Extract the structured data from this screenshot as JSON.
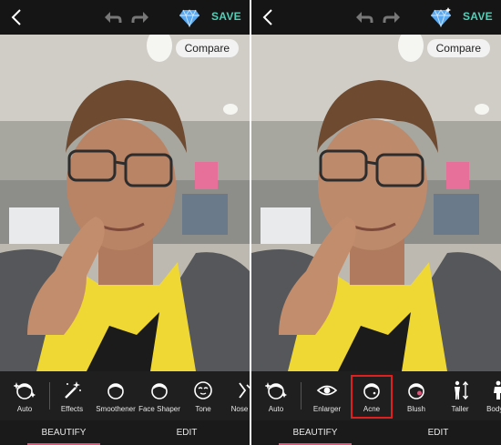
{
  "colors": {
    "accent": "#4fd1b8",
    "tab_indicator": "#e0547a",
    "highlight": "#e02020"
  },
  "left_screen": {
    "header": {
      "back_icon": "chevron-left-icon",
      "undo_icon": "undo-icon",
      "redo_icon": "redo-icon",
      "premium_icon": "diamond-icon",
      "save_label": "SAVE"
    },
    "compare_label": "Compare",
    "tools": [
      {
        "label": "Auto",
        "icon": "auto-face-icon"
      },
      {
        "label": "Effects",
        "icon": "magic-wand-icon"
      },
      {
        "label": "Smoothener",
        "icon": "face-smooth-icon"
      },
      {
        "label": "Face Shaper",
        "icon": "face-shaper-icon"
      },
      {
        "label": "Tone",
        "icon": "tone-icon"
      },
      {
        "label": "Nose En",
        "icon": "nose-icon"
      }
    ],
    "tabs": [
      {
        "label": "BEAUTIFY",
        "active": true
      },
      {
        "label": "EDIT",
        "active": false
      }
    ]
  },
  "right_screen": {
    "header": {
      "back_icon": "chevron-left-icon",
      "undo_icon": "undo-icon",
      "redo_icon": "redo-icon",
      "premium_icon": "diamond-sparkle-icon",
      "save_label": "SAVE"
    },
    "compare_label": "Compare",
    "tools": [
      {
        "label": "Auto",
        "icon": "auto-face-icon"
      },
      {
        "label": "Enlarger",
        "icon": "eye-icon"
      },
      {
        "label": "Acne",
        "icon": "acne-icon",
        "selected": true
      },
      {
        "label": "Blush",
        "icon": "blush-icon"
      },
      {
        "label": "Taller",
        "icon": "taller-icon"
      },
      {
        "label": "Body S",
        "icon": "body-icon"
      }
    ],
    "tabs": [
      {
        "label": "BEAUTIFY",
        "active": true
      },
      {
        "label": "EDIT",
        "active": false
      }
    ]
  }
}
